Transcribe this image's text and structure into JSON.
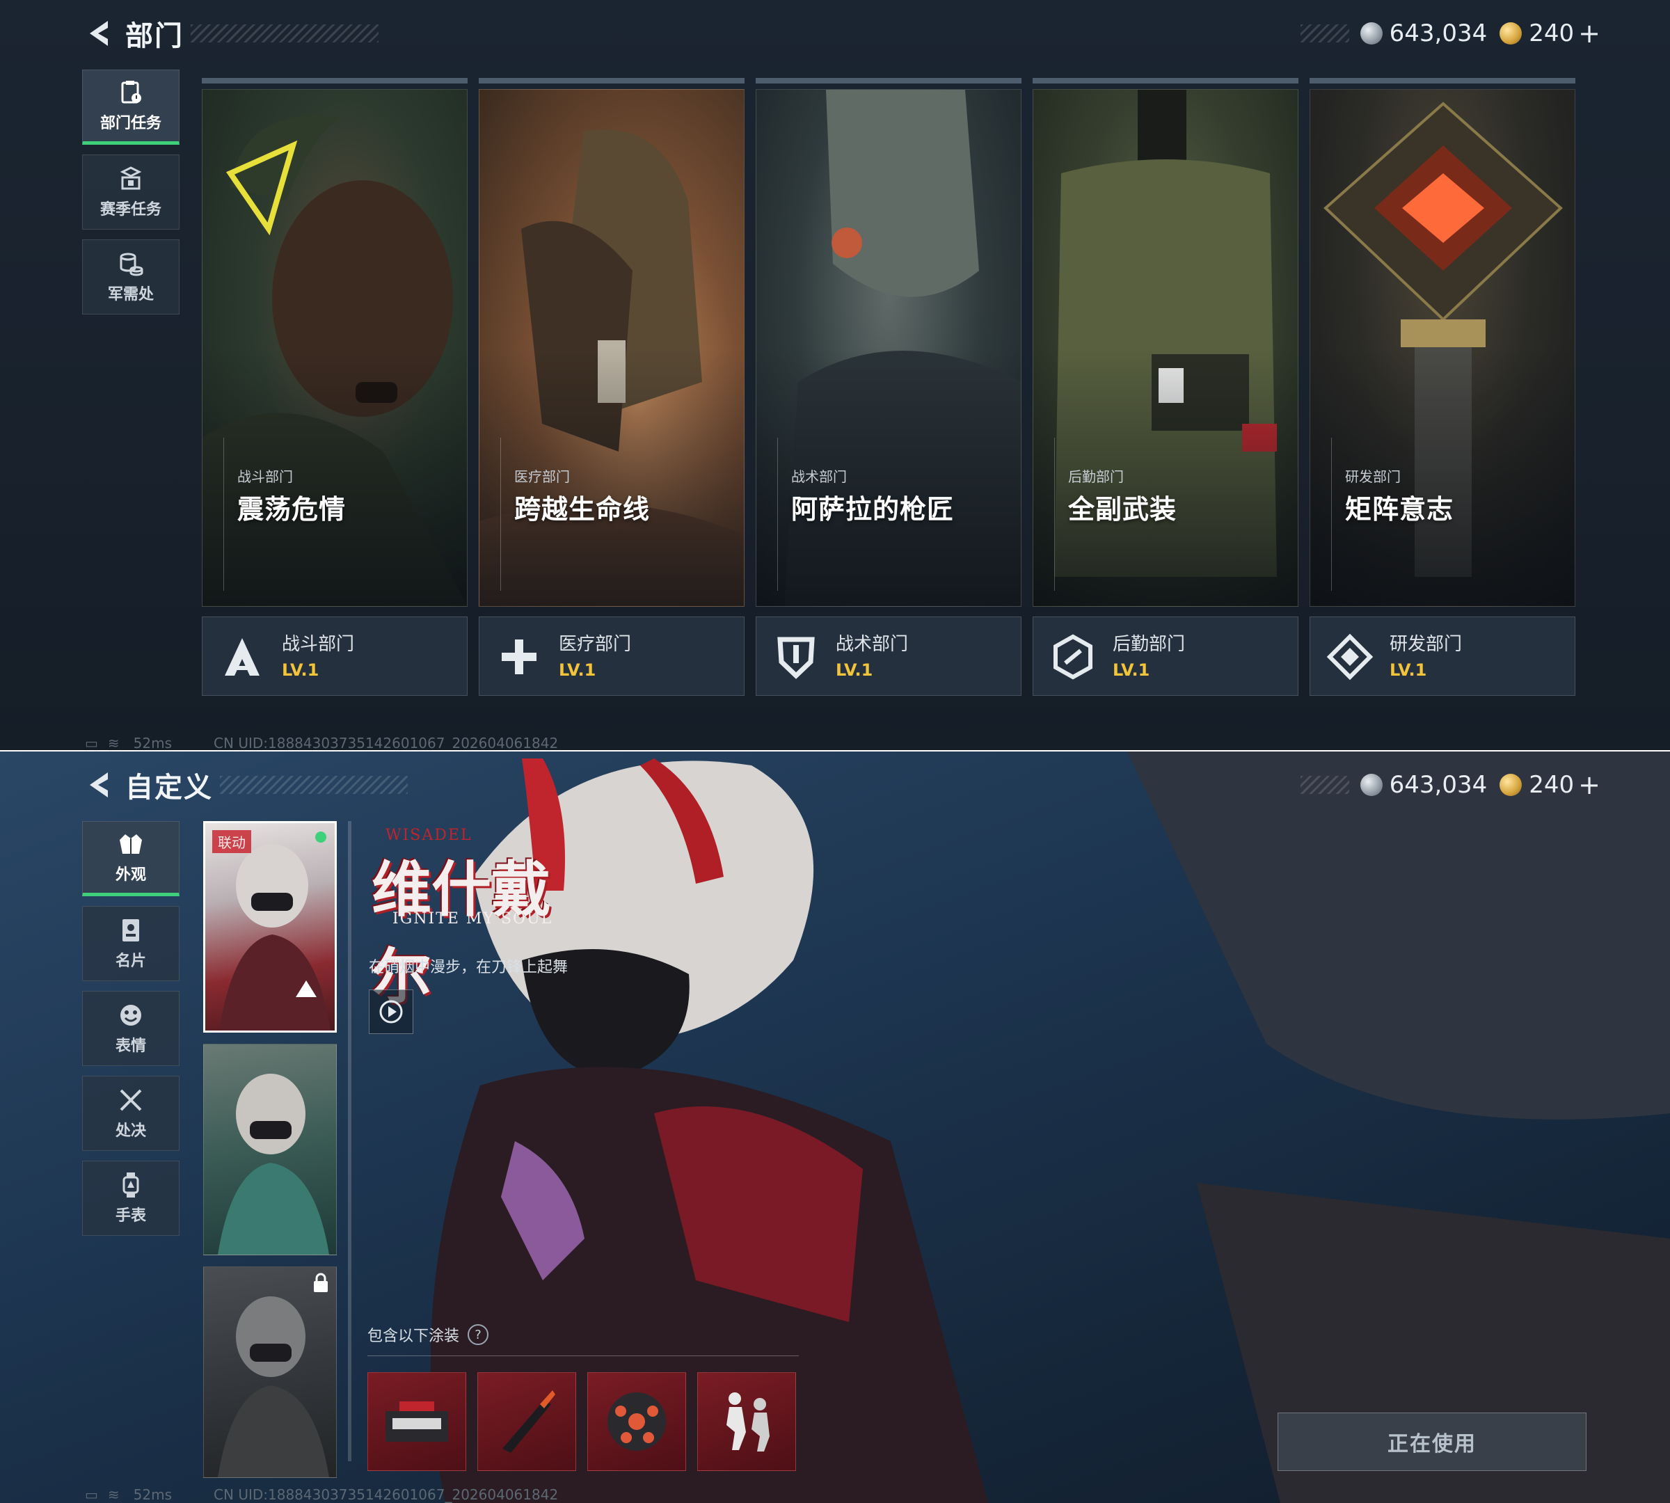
{
  "top": {
    "title": "部门",
    "currency": {
      "silver": "643,034",
      "gold": "240",
      "plus": "+"
    },
    "nav": [
      {
        "label": "部门任务",
        "active": true
      },
      {
        "label": "赛季任务",
        "active": false
      },
      {
        "label": "军需处",
        "active": false
      }
    ],
    "cards": [
      {
        "subtitle": "战斗部门",
        "name": "震荡危情",
        "dept": "战斗部门",
        "level": "LV.1"
      },
      {
        "subtitle": "医疗部门",
        "name": "跨越生命线",
        "dept": "医疗部门",
        "level": "LV.1"
      },
      {
        "subtitle": "战术部门",
        "name": "阿萨拉的枪匠",
        "dept": "战术部门",
        "level": "LV.1"
      },
      {
        "subtitle": "后勤部门",
        "name": "全副武装",
        "dept": "后勤部门",
        "level": "LV.1"
      },
      {
        "subtitle": "研发部门",
        "name": "矩阵意志",
        "dept": "研发部门",
        "level": "LV.1"
      }
    ],
    "status": {
      "ping": "52ms",
      "uid": "CN UID:18884303735142601067_202604061842"
    }
  },
  "bottom": {
    "title": "自定义",
    "currency": {
      "silver": "643,034",
      "gold": "240",
      "plus": "+"
    },
    "nav": [
      {
        "label": "外观",
        "active": true
      },
      {
        "label": "名片",
        "active": false
      },
      {
        "label": "表情",
        "active": false
      },
      {
        "label": "处决",
        "active": false
      },
      {
        "label": "手表",
        "active": false
      }
    ],
    "skins": {
      "collab_tag": "联动"
    },
    "logo": {
      "title": "维什戴尔",
      "subtitle": "IGNITE MY SOUL",
      "latin": "WISADEL"
    },
    "tagline": "在硝烟中漫步，在刀锋上起舞",
    "includes_label": "包含以下涂装",
    "help": "?",
    "use_button": "正在使用",
    "status": {
      "ping": "52ms",
      "uid": "CN UID:18884303735142601067_202604061842"
    }
  }
}
